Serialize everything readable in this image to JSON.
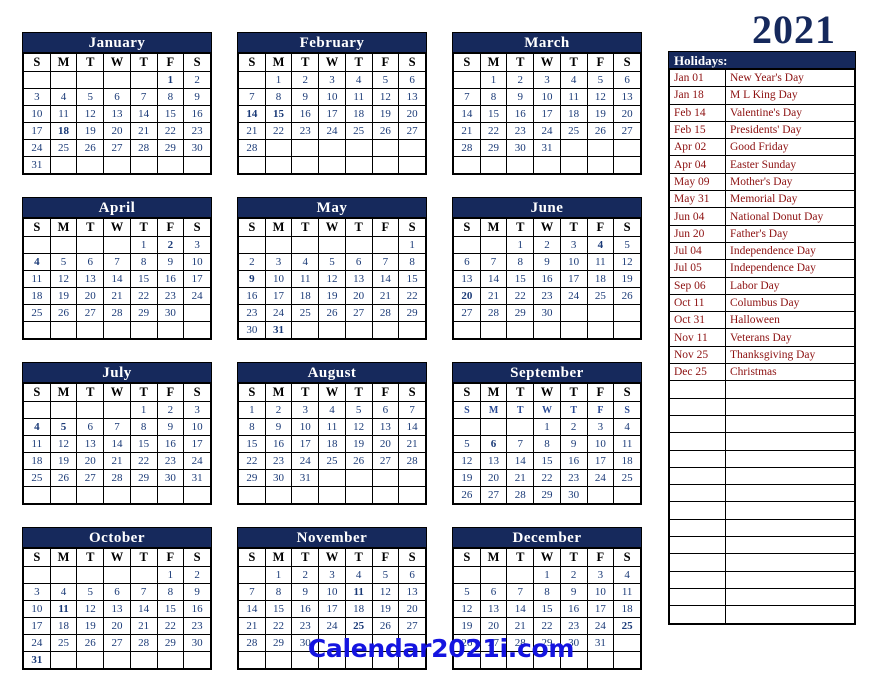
{
  "year": "2021",
  "footer": {
    "site": "Calendar2021i.com"
  },
  "colors": {
    "header_navy": "#16295c",
    "day_blue": "#1a3a77",
    "holiday_red": "#8c1010",
    "holiday_navy": "#14306e",
    "footer_blue": "#1414e0"
  },
  "weekday_headers": [
    "S",
    "M",
    "T",
    "W",
    "T",
    "F",
    "S"
  ],
  "months": [
    {
      "name": "January",
      "dup_header": false,
      "weeks": [
        [
          "",
          "",
          "",
          "",
          "",
          "1",
          "2"
        ],
        [
          "3",
          "4",
          "5",
          "6",
          "7",
          "8",
          "9"
        ],
        [
          "10",
          "11",
          "12",
          "13",
          "14",
          "15",
          "16"
        ],
        [
          "17",
          "18",
          "19",
          "20",
          "21",
          "22",
          "23"
        ],
        [
          "24",
          "25",
          "26",
          "27",
          "28",
          "29",
          "30"
        ],
        [
          "31",
          "",
          "",
          "",
          "",
          "",
          ""
        ]
      ],
      "red_days": [
        "1",
        "18"
      ],
      "navy_days": []
    },
    {
      "name": "February",
      "dup_header": false,
      "weeks": [
        [
          "",
          "1",
          "2",
          "3",
          "4",
          "5",
          "6"
        ],
        [
          "7",
          "8",
          "9",
          "10",
          "11",
          "12",
          "13"
        ],
        [
          "14",
          "15",
          "16",
          "17",
          "18",
          "19",
          "20"
        ],
        [
          "21",
          "22",
          "23",
          "24",
          "25",
          "26",
          "27"
        ],
        [
          "28",
          "",
          "",
          "",
          "",
          "",
          ""
        ],
        [
          "",
          "",
          "",
          "",
          "",
          "",
          ""
        ]
      ],
      "red_days": [
        "15"
      ],
      "navy_days": [
        "14"
      ]
    },
    {
      "name": "March",
      "dup_header": false,
      "weeks": [
        [
          "",
          "1",
          "2",
          "3",
          "4",
          "5",
          "6"
        ],
        [
          "7",
          "8",
          "9",
          "10",
          "11",
          "12",
          "13"
        ],
        [
          "14",
          "15",
          "16",
          "17",
          "18",
          "19",
          "20"
        ],
        [
          "21",
          "22",
          "23",
          "24",
          "25",
          "26",
          "27"
        ],
        [
          "28",
          "29",
          "30",
          "31",
          "",
          "",
          ""
        ],
        [
          "",
          "",
          "",
          "",
          "",
          "",
          ""
        ]
      ],
      "red_days": [],
      "navy_days": []
    },
    {
      "name": "April",
      "dup_header": false,
      "weeks": [
        [
          "",
          "",
          "",
          "",
          "1",
          "2",
          "3"
        ],
        [
          "4",
          "5",
          "6",
          "7",
          "8",
          "9",
          "10"
        ],
        [
          "11",
          "12",
          "13",
          "14",
          "15",
          "16",
          "17"
        ],
        [
          "18",
          "19",
          "20",
          "21",
          "22",
          "23",
          "24"
        ],
        [
          "25",
          "26",
          "27",
          "28",
          "29",
          "30",
          ""
        ],
        [
          "",
          "",
          "",
          "",
          "",
          "",
          ""
        ]
      ],
      "red_days": [
        "2"
      ],
      "navy_days": [
        "4"
      ]
    },
    {
      "name": "May",
      "dup_header": false,
      "weeks": [
        [
          "",
          "",
          "",
          "",
          "",
          "",
          "1"
        ],
        [
          "2",
          "3",
          "4",
          "5",
          "6",
          "7",
          "8"
        ],
        [
          "9",
          "10",
          "11",
          "12",
          "13",
          "14",
          "15"
        ],
        [
          "16",
          "17",
          "18",
          "19",
          "20",
          "21",
          "22"
        ],
        [
          "23",
          "24",
          "25",
          "26",
          "27",
          "28",
          "29"
        ],
        [
          "30",
          "31",
          "",
          "",
          "",
          "",
          ""
        ]
      ],
      "red_days": [
        "31"
      ],
      "navy_days": [
        "9"
      ]
    },
    {
      "name": "June",
      "dup_header": false,
      "weeks": [
        [
          "",
          "",
          "1",
          "2",
          "3",
          "4",
          "5"
        ],
        [
          "6",
          "7",
          "8",
          "9",
          "10",
          "11",
          "12"
        ],
        [
          "13",
          "14",
          "15",
          "16",
          "17",
          "18",
          "19"
        ],
        [
          "20",
          "21",
          "22",
          "23",
          "24",
          "25",
          "26"
        ],
        [
          "27",
          "28",
          "29",
          "30",
          "",
          "",
          ""
        ],
        [
          "",
          "",
          "",
          "",
          "",
          "",
          ""
        ]
      ],
      "red_days": [
        "4"
      ],
      "navy_days": [
        "20"
      ]
    },
    {
      "name": "July",
      "dup_header": false,
      "weeks": [
        [
          "",
          "",
          "",
          "",
          "1",
          "2",
          "3"
        ],
        [
          "4",
          "5",
          "6",
          "7",
          "8",
          "9",
          "10"
        ],
        [
          "11",
          "12",
          "13",
          "14",
          "15",
          "16",
          "17"
        ],
        [
          "18",
          "19",
          "20",
          "21",
          "22",
          "23",
          "24"
        ],
        [
          "25",
          "26",
          "27",
          "28",
          "29",
          "30",
          "31"
        ],
        [
          "",
          "",
          "",
          "",
          "",
          "",
          ""
        ]
      ],
      "red_days": [
        "5"
      ],
      "navy_days": [
        "4"
      ]
    },
    {
      "name": "August",
      "dup_header": false,
      "weeks": [
        [
          "1",
          "2",
          "3",
          "4",
          "5",
          "6",
          "7"
        ],
        [
          "8",
          "9",
          "10",
          "11",
          "12",
          "13",
          "14"
        ],
        [
          "15",
          "16",
          "17",
          "18",
          "19",
          "20",
          "21"
        ],
        [
          "22",
          "23",
          "24",
          "25",
          "26",
          "27",
          "28"
        ],
        [
          "29",
          "30",
          "31",
          "",
          "",
          "",
          ""
        ],
        [
          "",
          "",
          "",
          "",
          "",
          "",
          ""
        ]
      ],
      "red_days": [],
      "navy_days": []
    },
    {
      "name": "September",
      "dup_header": true,
      "weeks": [
        [
          "",
          "",
          "",
          "1",
          "2",
          "3",
          "4"
        ],
        [
          "5",
          "6",
          "7",
          "8",
          "9",
          "10",
          "11"
        ],
        [
          "12",
          "13",
          "14",
          "15",
          "16",
          "17",
          "18"
        ],
        [
          "19",
          "20",
          "21",
          "22",
          "23",
          "24",
          "25"
        ],
        [
          "26",
          "27",
          "28",
          "29",
          "30",
          "",
          ""
        ]
      ],
      "red_days": [
        "6"
      ],
      "navy_days": []
    },
    {
      "name": "October",
      "dup_header": false,
      "weeks": [
        [
          "",
          "",
          "",
          "",
          "",
          "1",
          "2"
        ],
        [
          "3",
          "4",
          "5",
          "6",
          "7",
          "8",
          "9"
        ],
        [
          "10",
          "11",
          "12",
          "13",
          "14",
          "15",
          "16"
        ],
        [
          "17",
          "18",
          "19",
          "20",
          "21",
          "22",
          "23"
        ],
        [
          "24",
          "25",
          "26",
          "27",
          "28",
          "29",
          "30"
        ],
        [
          "31",
          "",
          "",
          "",
          "",
          "",
          ""
        ]
      ],
      "red_days": [
        "11"
      ],
      "navy_days": [
        "31"
      ]
    },
    {
      "name": "November",
      "dup_header": false,
      "weeks": [
        [
          "",
          "1",
          "2",
          "3",
          "4",
          "5",
          "6"
        ],
        [
          "7",
          "8",
          "9",
          "10",
          "11",
          "12",
          "13"
        ],
        [
          "14",
          "15",
          "16",
          "17",
          "18",
          "19",
          "20"
        ],
        [
          "21",
          "22",
          "23",
          "24",
          "25",
          "26",
          "27"
        ],
        [
          "28",
          "29",
          "30",
          "",
          "",
          "",
          ""
        ],
        [
          "",
          "",
          "",
          "",
          "",
          "",
          ""
        ]
      ],
      "red_days": [
        "11",
        "25"
      ],
      "navy_days": []
    },
    {
      "name": "December",
      "dup_header": false,
      "weeks": [
        [
          "",
          "",
          "",
          "1",
          "2",
          "3",
          "4"
        ],
        [
          "5",
          "6",
          "7",
          "8",
          "9",
          "10",
          "11"
        ],
        [
          "12",
          "13",
          "14",
          "15",
          "16",
          "17",
          "18"
        ],
        [
          "19",
          "20",
          "21",
          "22",
          "23",
          "24",
          "25"
        ],
        [
          "26",
          "27",
          "28",
          "29",
          "30",
          "31",
          ""
        ],
        [
          "",
          "",
          "",
          "",
          "",
          "",
          ""
        ]
      ],
      "red_days": [],
      "navy_days": [
        "25"
      ]
    }
  ],
  "holidays": {
    "title": "Holidays:",
    "items": [
      {
        "date": "Jan 01",
        "name": "New Year's Day"
      },
      {
        "date": "Jan 18",
        "name": "M L King Day"
      },
      {
        "date": "Feb 14",
        "name": "Valentine's Day"
      },
      {
        "date": "Feb 15",
        "name": "Presidents' Day"
      },
      {
        "date": "Apr 02",
        "name": "Good Friday"
      },
      {
        "date": "Apr 04",
        "name": "Easter Sunday"
      },
      {
        "date": "May 09",
        "name": "Mother's Day"
      },
      {
        "date": "May 31",
        "name": "Memorial Day"
      },
      {
        "date": "Jun 04",
        "name": "National Donut Day"
      },
      {
        "date": "Jun 20",
        "name": "Father's Day"
      },
      {
        "date": "Jul 04",
        "name": "Independence Day"
      },
      {
        "date": "Jul 05",
        "name": "Independence Day"
      },
      {
        "date": "Sep 06",
        "name": "Labor Day"
      },
      {
        "date": "Oct 11",
        "name": "Columbus Day"
      },
      {
        "date": "Oct 31",
        "name": "Halloween"
      },
      {
        "date": "Nov 11",
        "name": "Veterans Day"
      },
      {
        "date": "Nov 25",
        "name": "Thanksgiving Day"
      },
      {
        "date": "Dec 25",
        "name": "Christmas"
      }
    ],
    "blank_rows": 14
  }
}
